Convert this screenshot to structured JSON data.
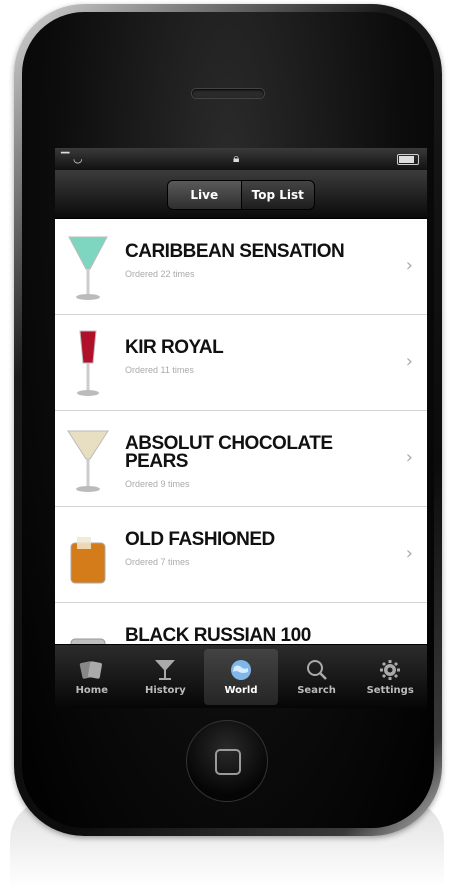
{
  "segmented": {
    "live": "Live",
    "top": "Top List"
  },
  "drinks": [
    {
      "name": "CARIBBEAN SENSATION",
      "sub": "Ordered 22 times",
      "icon": "cocktail-glass-icon",
      "color": "#7fd6c0"
    },
    {
      "name": "KIR ROYAL",
      "sub": "Ordered 11 times",
      "icon": "champagne-flute-icon",
      "color": "#b0102a"
    },
    {
      "name": "ABSOLUT CHOCOLATE PEARS",
      "sub": "Ordered 9 times",
      "icon": "martini-glass-icon",
      "color": "#e8dfc2"
    },
    {
      "name": "OLD FASHIONED",
      "sub": "Ordered 7 times",
      "icon": "rocks-glass-icon",
      "color": "#d47b1a"
    },
    {
      "name": "BLACK RUSSIAN 100",
      "sub": "",
      "icon": "rocks-glass-icon",
      "color": "#c0c0c0"
    }
  ],
  "tabs": [
    {
      "label": "Home",
      "icon": "cards-icon"
    },
    {
      "label": "History",
      "icon": "cocktail-icon"
    },
    {
      "label": "World",
      "icon": "globe-icon"
    },
    {
      "label": "Search",
      "icon": "search-icon"
    },
    {
      "label": "Settings",
      "icon": "gear-icon"
    }
  ],
  "chevron": "›"
}
